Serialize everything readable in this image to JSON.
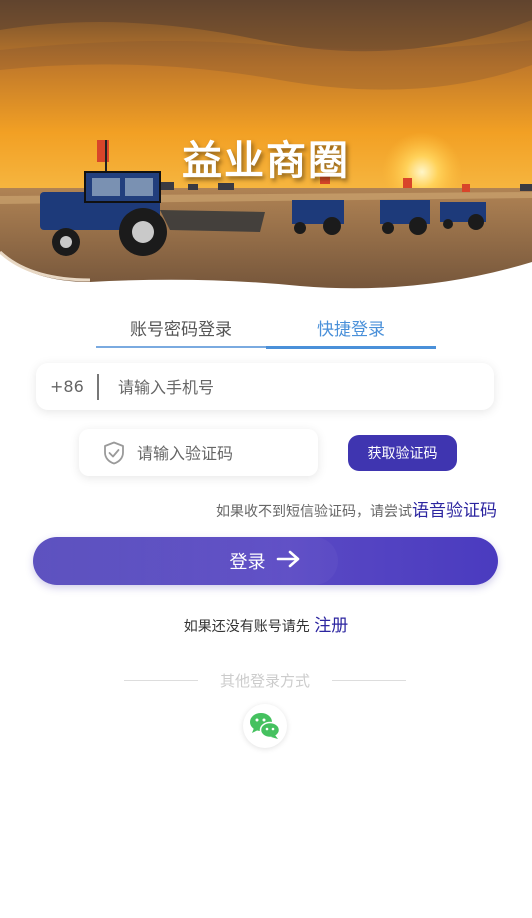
{
  "hero": {
    "brand_title": "益业商圈"
  },
  "tabs": [
    {
      "label": "账号密码登录",
      "active": false
    },
    {
      "label": "快捷登录",
      "active": true
    }
  ],
  "phone": {
    "country_code": "+86",
    "placeholder": "请输入手机号",
    "value": ""
  },
  "code": {
    "placeholder": "请输入验证码",
    "value": "",
    "icon": "shield-check-icon",
    "get_code_label": "获取验证码"
  },
  "voice": {
    "prefix_text": "如果收不到短信验证码，请尝试",
    "link_label": "语音验证码"
  },
  "login": {
    "label": "登录",
    "icon": "arrow-right-icon"
  },
  "register": {
    "prefix_text": "如果还没有账号请先",
    "link_label": "注册"
  },
  "other_login": {
    "label": "其他登录方式",
    "methods": [
      "wechat-icon"
    ]
  },
  "colors": {
    "primary": "#3f35b0",
    "tab_active": "#4a90d9",
    "link": "#2c25a0",
    "wechat": "#45c15f"
  }
}
